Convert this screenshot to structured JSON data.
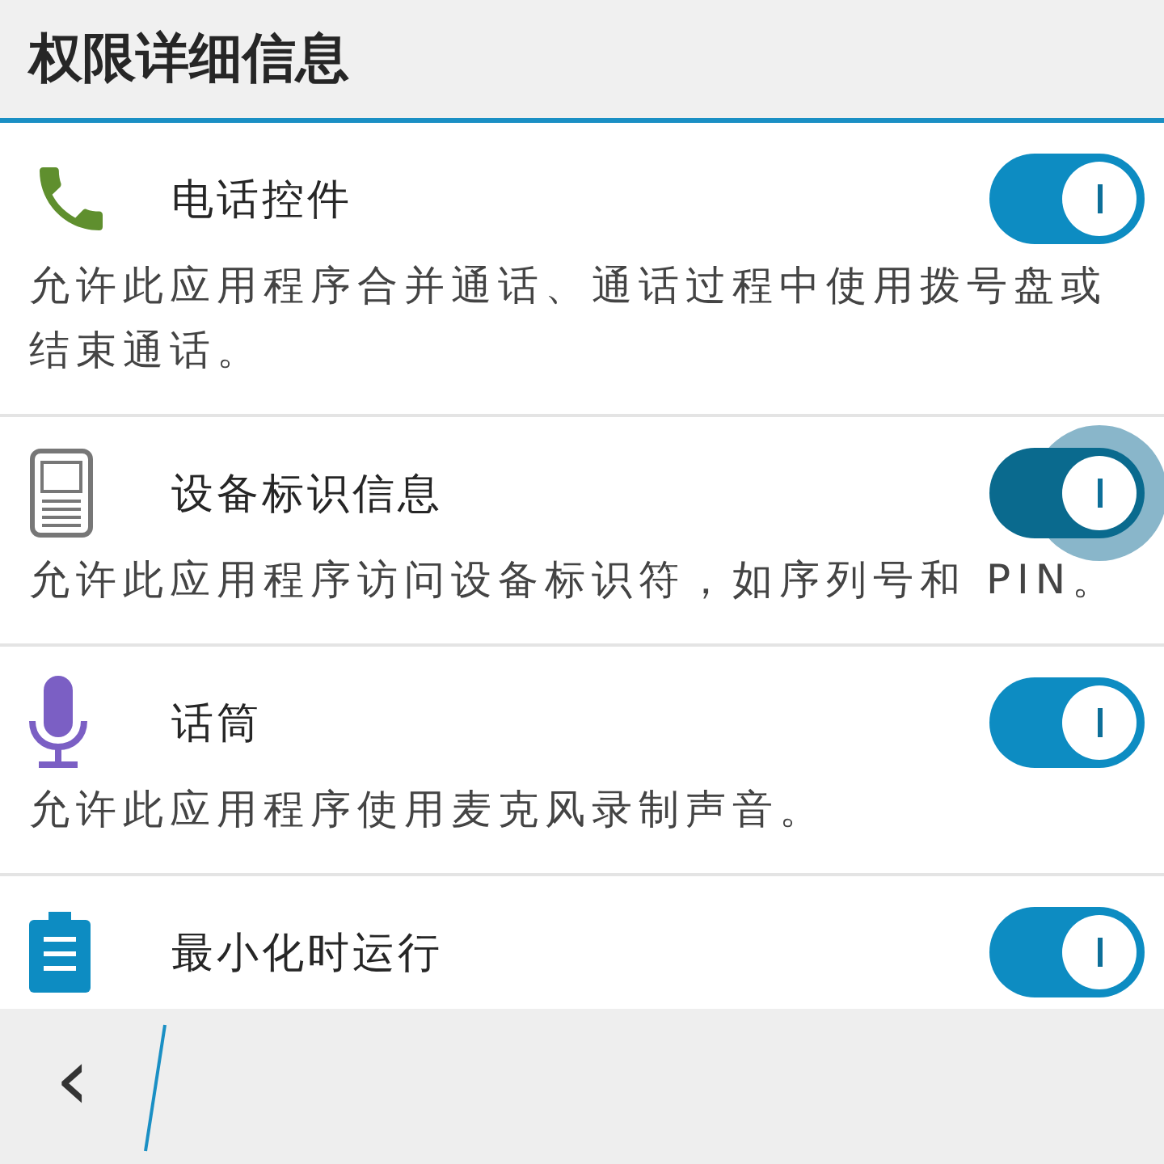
{
  "header": {
    "title": "权限详细信息"
  },
  "permissions": [
    {
      "name": "电话控件",
      "description": "允许此应用程序合并通话、通话过程中使用拨号盘或结束通话。",
      "on": true,
      "focused": false
    },
    {
      "name": "设备标识信息",
      "description": "允许此应用程序访问设备标识符，如序列号和 PIN。",
      "on": true,
      "focused": true
    },
    {
      "name": "话筒",
      "description": "允许此应用程序使用麦克风录制声音。",
      "on": true,
      "focused": false
    },
    {
      "name": "最小化时运行",
      "on": true,
      "focused": false
    }
  ],
  "bottom_bar": {
    "back": "‹"
  }
}
